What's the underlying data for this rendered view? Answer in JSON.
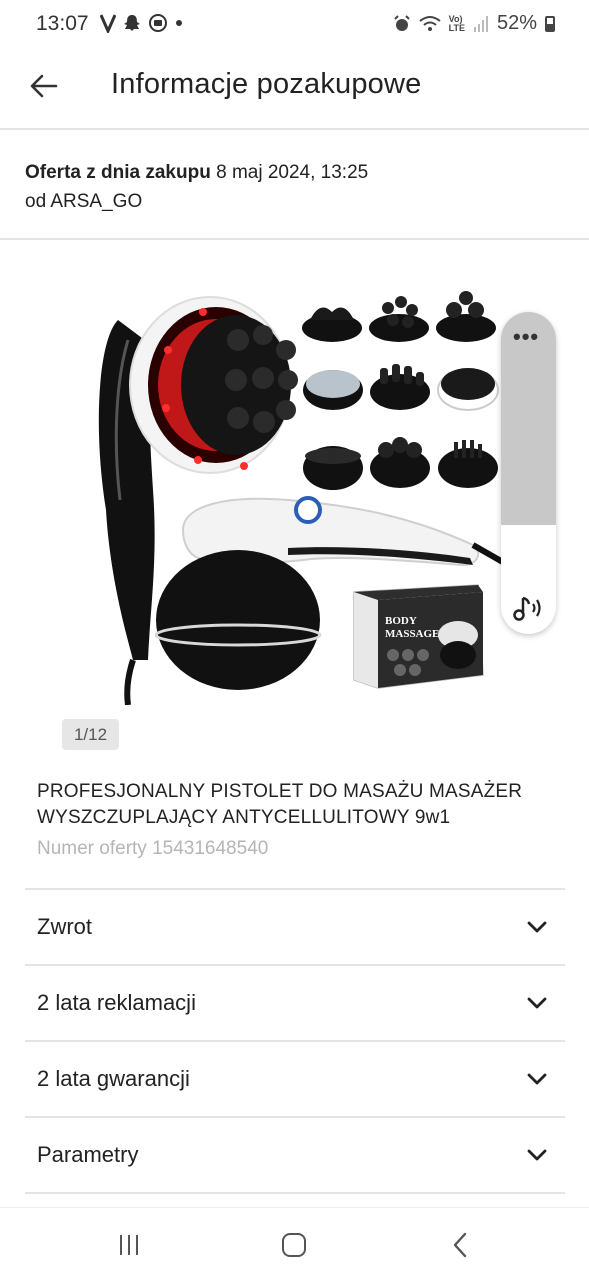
{
  "status_bar": {
    "time": "13:07",
    "battery": "52%",
    "network": "LTE",
    "icons_left": [
      "v-app-icon",
      "snapchat-icon",
      "whatsapp-icon",
      "dot-icon"
    ],
    "icons_right": [
      "alarm-icon",
      "wifi-icon",
      "volte-icon",
      "signal-icon",
      "battery-icon"
    ]
  },
  "header": {
    "title": "Informacje pozakupowe",
    "back_icon": "back-arrow-icon"
  },
  "offer": {
    "date_prefix": "Oferta z dnia zakupu",
    "date_value": "8 maj 2024, 13:25",
    "seller_line": "od ARSA_GO"
  },
  "gallery": {
    "counter": "1/12",
    "box_label_line1": "BODY",
    "box_label_line2": "MASSAGER",
    "side_panel": {
      "menu_icon": "more-dots-icon",
      "sound_icon": "music-sound-icon",
      "level": 0.66
    }
  },
  "product": {
    "title": "PROFESJONALNY PISTOLET DO MASAŻU MASAŻER WYSZCZUPLAJĄCY ANTYCELLULITOWY 9w1",
    "offer_number_label": "Numer oferty 15431648540"
  },
  "accordion": [
    {
      "label": "Zwrot"
    },
    {
      "label": "2 lata reklamacji"
    },
    {
      "label": "2 lata gwarancji"
    },
    {
      "label": "Parametry"
    }
  ],
  "nav": {
    "recents_icon": "recents-icon",
    "home_icon": "home-icon",
    "back_icon": "nav-back-icon"
  },
  "colors": {
    "divider": "#e4e4e4",
    "muted_text": "#b5b5b5",
    "counter_bg": "#e6e6e6",
    "massager_red": "#e8232a"
  }
}
